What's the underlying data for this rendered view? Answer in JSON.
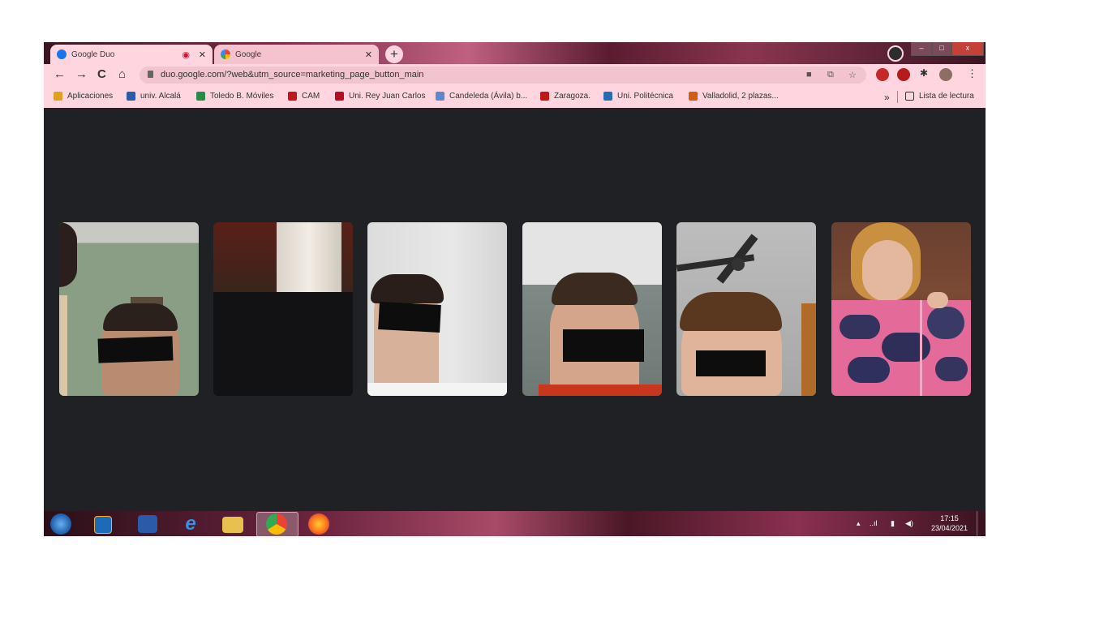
{
  "browser": {
    "tabs": [
      {
        "title": "Google Duo",
        "active": true,
        "favicon": "duo-icon",
        "has_record_indicator": true
      },
      {
        "title": "Google",
        "active": false,
        "favicon": "google-icon"
      }
    ],
    "new_tab": "+",
    "window_controls": {
      "minimize": "–",
      "maximize": "□",
      "close": "x"
    },
    "address_bar": {
      "url": "duo.google.com/?web&utm_source=marketing_page_button_main"
    },
    "nav": {
      "back": "←",
      "forward": "→",
      "reload": "C",
      "home": "⌂"
    },
    "toolbar_icons": [
      "video-camera-icon",
      "share-icon",
      "star-icon"
    ],
    "extensions": [
      "extension-red-icon",
      "adblock-icon",
      "puzzle-icon",
      "profile-avatar-icon"
    ],
    "menu": "⋮"
  },
  "bookmarks": {
    "items": [
      {
        "label": "Aplicaciones",
        "icon": "apps-grid-icon",
        "color": "#e0a020"
      },
      {
        "label": "univ. Alcalá",
        "icon": "university-icon",
        "color": "#2a5aa8"
      },
      {
        "label": "Toledo B. Móviles",
        "icon": "building-icon",
        "color": "#2a8a4a"
      },
      {
        "label": "CAM",
        "icon": "cam-icon",
        "color": "#c01818"
      },
      {
        "label": "Uni. Rey Juan Carlos",
        "icon": "urjc-icon",
        "color": "#b01020"
      },
      {
        "label": "Candeleda (Ávila) b...",
        "icon": "bank-icon",
        "color": "#5a8acc"
      },
      {
        "label": "Zaragoza.",
        "icon": "zaragoza-icon",
        "color": "#c01818"
      },
      {
        "label": "Uni. Politécnica",
        "icon": "upm-icon",
        "color": "#2a6ab0"
      },
      {
        "label": "Valladolid, 2 plazas...",
        "icon": "valladolid-icon",
        "color": "#d06010"
      }
    ],
    "overflow": "»",
    "reading_list": "Lista de lectura"
  },
  "call": {
    "participants": [
      {
        "name": "participant-1",
        "video": "boy-green-wall"
      },
      {
        "name": "participant-2",
        "video": "dark-room"
      },
      {
        "name": "participant-3",
        "video": "girl-white-wall"
      },
      {
        "name": "participant-4",
        "video": "boy-grey-wall"
      },
      {
        "name": "participant-5",
        "video": "boy-ceiling-fan"
      },
      {
        "name": "participant-6",
        "video": "teacher-with-artwork"
      }
    ]
  },
  "taskbar": {
    "apps": [
      "windows-start-icon",
      "media-player-icon",
      "word-icon",
      "internet-explorer-icon",
      "file-explorer-icon",
      "chrome-icon",
      "firefox-icon"
    ],
    "tray": {
      "show_hidden": "▴",
      "signal": "..ıl",
      "battery": "▮",
      "volume": "◀)"
    },
    "clock": {
      "time": "17:15",
      "date": "23/04/2021"
    }
  }
}
